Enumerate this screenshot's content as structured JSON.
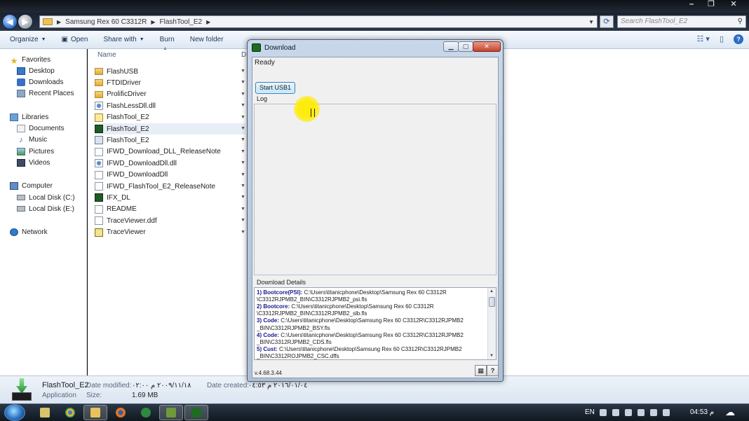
{
  "explorer": {
    "breadcrumb": [
      "Samsung Rex 60 C3312R",
      "FlashTool_E2"
    ],
    "search_placeholder": "Search FlashTool_E2",
    "toolbar": {
      "organize": "Organize",
      "open": "Open",
      "share_with": "Share with",
      "burn": "Burn",
      "new_folder": "New folder"
    },
    "columns": {
      "name": "Name",
      "date": "D"
    },
    "sidebar": {
      "favorites": "Favorites",
      "desktop": "Desktop",
      "downloads": "Downloads",
      "recent": "Recent Places",
      "libraries": "Libraries",
      "documents": "Documents",
      "music": "Music",
      "pictures": "Pictures",
      "videos": "Videos",
      "computer": "Computer",
      "local_c": "Local Disk (C:)",
      "local_e": "Local Disk (E:)",
      "network": "Network"
    },
    "files": [
      {
        "name": "FlashUSB",
        "icon": "folder-icon"
      },
      {
        "name": "FTDIDriver",
        "icon": "folder-icon"
      },
      {
        "name": "ProlificDriver",
        "icon": "folder-icon"
      },
      {
        "name": "FlashLessDll.dll",
        "icon": "dll-icon"
      },
      {
        "name": "FlashTool_E2",
        "icon": "help-file-icon"
      },
      {
        "name": "FlashTool_E2",
        "icon": "flashtool-app-icon"
      },
      {
        "name": "FlashTool_E2",
        "icon": "config-file-icon"
      },
      {
        "name": "IFWD_Download_DLL_ReleaseNote",
        "icon": "document-icon"
      },
      {
        "name": "IFWD_DownloadDll.dll",
        "icon": "dll-icon"
      },
      {
        "name": "IFWD_DownloadDll",
        "icon": "document-icon"
      },
      {
        "name": "IFWD_FlashTool_E2_ReleaseNote",
        "icon": "document-icon"
      },
      {
        "name": "IFX_DL",
        "icon": "flashtool-app-icon"
      },
      {
        "name": "README",
        "icon": "document-icon"
      },
      {
        "name": "TraceViewer.ddf",
        "icon": "document-icon"
      },
      {
        "name": "TraceViewer",
        "icon": "traceviewer-icon"
      }
    ],
    "details": {
      "name": "FlashTool_E2",
      "type": "Application",
      "date_modified_label": "Date modified:",
      "date_modified": "٢٠٠٩/١١/١٨ م ٠٢:٠٠",
      "date_created_label": "Date created:",
      "date_created": "٢٠١٦/٠١/٠٤ م ٠٤:٥٣",
      "size_label": "Size:",
      "size": "1.69 MB"
    }
  },
  "dialog": {
    "title": "Download",
    "status": "Ready",
    "start_button": "Start USB1",
    "log_label": "Log",
    "details_label": "Download Details",
    "details": [
      {
        "tag": "1) Bootcore(PSI):",
        "path": "C:\\Users\\titanicphone\\Desktop\\Samsung Rex 60 C3312R"
      },
      {
        "tag": "",
        "path": "\\C3312RJPMB2_BIN\\C3312RJPMB2_psi.fls"
      },
      {
        "tag": "2) Bootcore:",
        "path": "C:\\Users\\titanicphone\\Desktop\\Samsung Rex 60 C3312R"
      },
      {
        "tag": "",
        "path": "\\C3312RJPMB2_BIN\\C3312RJPMB2_slb.fls"
      },
      {
        "tag": "3) Code:",
        "path": "C:\\Users\\titanicphone\\Desktop\\Samsung Rex 60 C3312R\\C3312RJPMB2"
      },
      {
        "tag": "",
        "path": "_BIN\\C3312RJPMB2_BSY.fls"
      },
      {
        "tag": "4) Code:",
        "path": "C:\\Users\\titanicphone\\Desktop\\Samsung Rex 60 C3312R\\C3312RJPMB2"
      },
      {
        "tag": "",
        "path": "_BIN\\C3312RJPMB2_CDS.fls"
      },
      {
        "tag": "5) Cust:",
        "path": "C:\\Users\\titanicphone\\Desktop\\Samsung Rex 60 C3312R\\C3312RJPMB2"
      },
      {
        "tag": "",
        "path": "_BIN\\C3312ROJPMB2_CSC.dffs"
      }
    ],
    "version": "v.4.68.3.44",
    "help_button": "?"
  },
  "taskbar": {
    "language": "EN",
    "clock": "04:53 م"
  }
}
